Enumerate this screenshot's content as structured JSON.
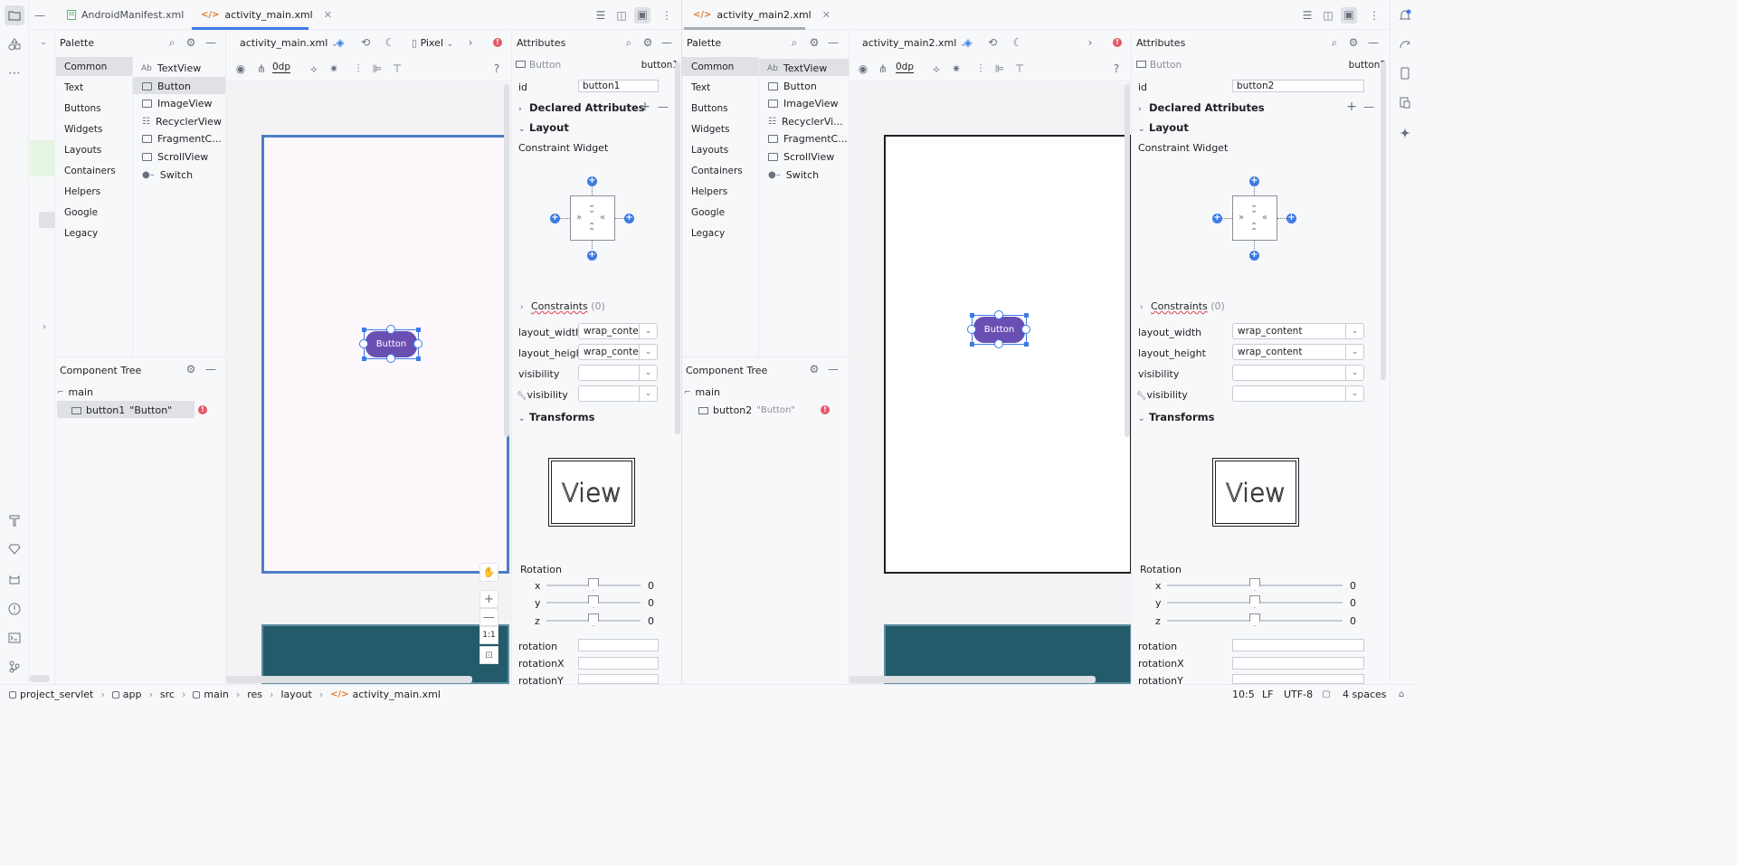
{
  "tabs": {
    "left": [
      {
        "label": "AndroidManifest.xml",
        "active": false
      },
      {
        "label": "activity_main.xml",
        "active": true
      }
    ],
    "right": [
      {
        "label": "activity_main2.xml",
        "active": true
      }
    ]
  },
  "palette": {
    "title": "Palette",
    "categories": [
      "Common",
      "Text",
      "Buttons",
      "Widgets",
      "Layouts",
      "Containers",
      "Helpers",
      "Google",
      "Legacy"
    ],
    "items_left": [
      "TextView",
      "Button",
      "ImageView",
      "RecyclerView",
      "FragmentC...",
      "ScrollView",
      "Switch"
    ],
    "items_right": [
      "TextView",
      "Button",
      "ImageView",
      "RecyclerVi...",
      "FragmentC...",
      "ScrollView",
      "Switch"
    ],
    "textview_prefix": "Ab"
  },
  "design_toolbar": {
    "left_file": "activity_main.xml",
    "right_file": "activity_main2.xml",
    "device": "Pixel",
    "dp": "0dp",
    "help": "?"
  },
  "component_tree": {
    "title": "Component Tree",
    "root": "main",
    "left_child": "button1",
    "left_child_text": "\"Button\"",
    "right_child": "button2",
    "right_child_text": "\"Button\""
  },
  "canvas": {
    "left_button_label": "Button",
    "right_button_label": "Button",
    "zoom_fit": "1:1"
  },
  "attributes_left": {
    "title": "Attributes",
    "widget_type": "Button",
    "widget_id": "button1",
    "id_label": "id",
    "id_value": "button1",
    "declared": "Declared Attributes",
    "layout": "Layout",
    "constraint_widget": "Constraint Widget",
    "constraints": "Constraints",
    "constraints_count": "(0)",
    "layout_width_label": "layout_width",
    "layout_width_value": "wrap_conte",
    "layout_height_label": "layout_height",
    "layout_height_value": "wrap_conte",
    "visibility_label": "visibility",
    "tools_visibility_label": "visibility",
    "transforms": "Transforms",
    "view_preview": "View",
    "rotation_title": "Rotation",
    "rot_x": "x",
    "rot_y": "y",
    "rot_z": "z",
    "rot_x_value": "0",
    "rot_y_value": "0",
    "rot_z_value": "0",
    "rotation_label": "rotation",
    "rotationX_label": "rotationX",
    "rotationY_label": "rotationY"
  },
  "attributes_right": {
    "title": "Attributes",
    "widget_type": "Button",
    "widget_id": "button2",
    "id_label": "id",
    "id_value": "button2",
    "declared": "Declared Attributes",
    "layout": "Layout",
    "constraint_widget": "Constraint Widget",
    "constraints": "Constraints",
    "constraints_count": "(0)",
    "layout_width_label": "layout_width",
    "layout_width_value": "wrap_content",
    "layout_height_label": "layout_height",
    "layout_height_value": "wrap_content",
    "visibility_label": "visibility",
    "tools_visibility_label": "visibility",
    "transforms": "Transforms",
    "view_preview": "View",
    "rotation_title": "Rotation",
    "rot_x": "x",
    "rot_y": "y",
    "rot_z": "z",
    "rot_x_value": "0",
    "rot_y_value": "0",
    "rot_z_value": "0",
    "rotation_label": "rotation",
    "rotationX_label": "rotationX",
    "rotationY_label": "rotationY"
  },
  "breadcrumb": [
    "project_servlet",
    "app",
    "src",
    "main",
    "res",
    "layout",
    "activity_main.xml"
  ],
  "status": {
    "position": "10:5",
    "line_sep": "LF",
    "encoding": "UTF-8",
    "indent": "4 spaces"
  },
  "colors": {
    "accent": "#3b7be8",
    "button_purple": "#6a4fb3",
    "error": "#e55765",
    "blueprint": "#245b6a"
  }
}
